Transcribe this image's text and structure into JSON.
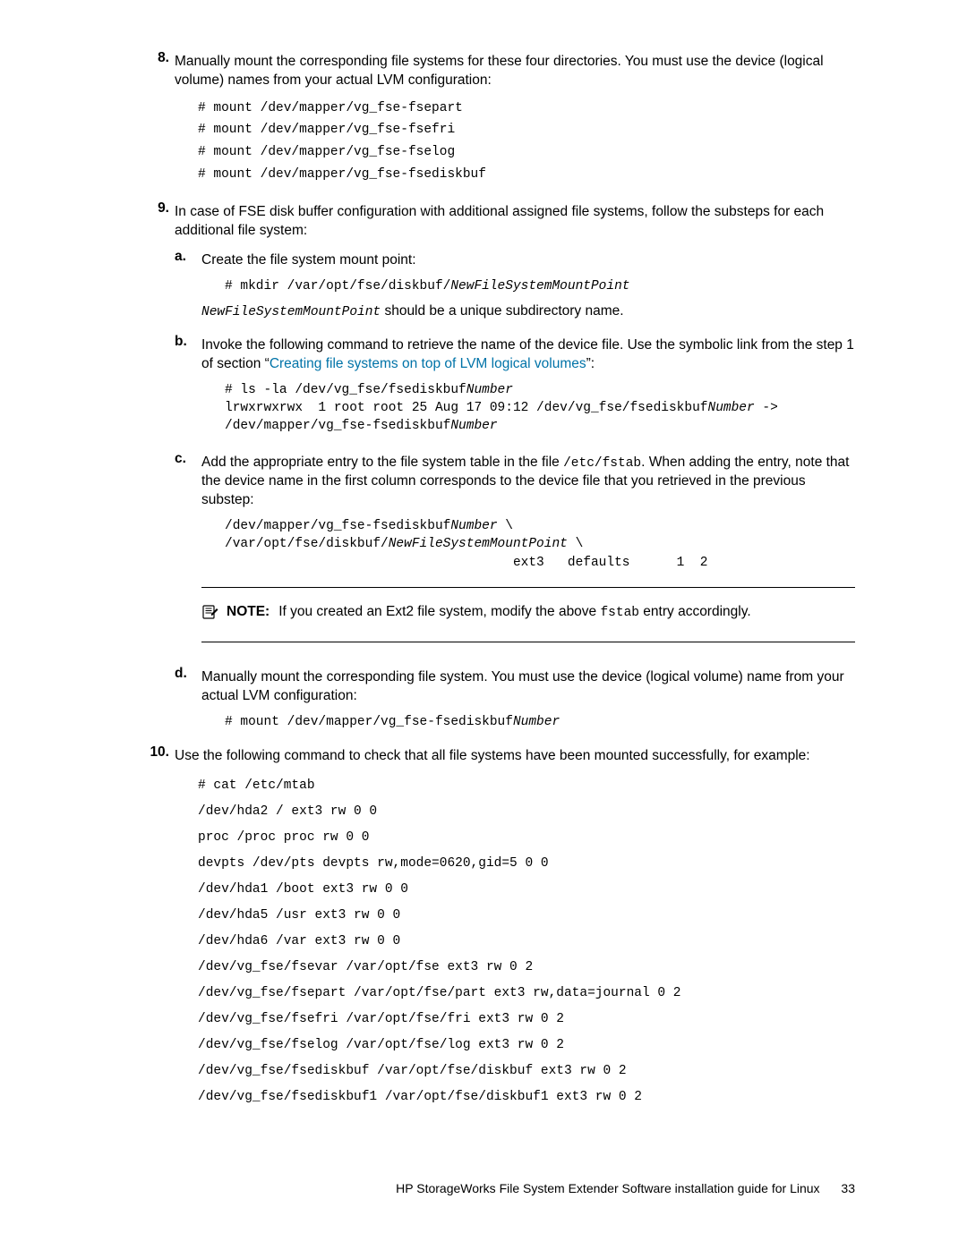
{
  "step8": {
    "num": "8.",
    "text": "Manually mount the corresponding file systems for these four directories. You must use the device (logical volume) names from your actual LVM configuration:",
    "code": "# mount /dev/mapper/vg_fse-fsepart\n# mount /dev/mapper/vg_fse-fsefri\n# mount /dev/mapper/vg_fse-fselog\n# mount /dev/mapper/vg_fse-fsediskbuf"
  },
  "step9": {
    "num": "9.",
    "text": "In case of FSE disk buffer configuration with additional assigned file systems, follow the substeps for each additional file system:",
    "a": {
      "num": "a.",
      "text": "Create the file system mount point:",
      "code_prefix": "# mkdir /var/opt/fse/diskbuf/",
      "code_italic": "NewFileSystemMountPoint",
      "after_italic": "NewFileSystemMountPoint",
      "after_text": " should be a unique subdirectory name."
    },
    "b": {
      "num": "b.",
      "text_pre": "Invoke the following command to retrieve the name of the device file. Use the symbolic link from the step 1 of section “",
      "link": "Creating file systems on top of LVM logical volumes",
      "text_post": "”:",
      "code1_prefix": "# ls -la /dev/vg_fse/fsediskbuf",
      "code1_it": "Number",
      "code2_p1": "lrwxrwxrwx  1 root root 25 Aug 17 09:12 /dev/vg_fse/fsediskbuf",
      "code2_it1": "Number",
      "code2_p2": " ->",
      "code3_p1": "/dev/mapper/vg_fse-fsediskbuf",
      "code3_it1": "Number"
    },
    "c": {
      "num": "c.",
      "t1": "Add the appropriate entry to the file system table in the file ",
      "m1": "/etc/fstab",
      "t2": ". When adding the entry, note that the device name in the first column corresponds to the device file that you retrieved in the previous substep:",
      "cl1a": "/dev/mapper/vg_fse-fsediskbuf",
      "cl1i": "Number",
      "cl1b": " \\",
      "cl2a": "/var/opt/fse/diskbuf/",
      "cl2i": "NewFileSystemMountPoint",
      "cl2b": " \\",
      "cl3": "                                     ext3   defaults      1  2"
    },
    "note": {
      "label": "NOTE:",
      "t1": "If you created an Ext2 file system, modify the above ",
      "m1": "fstab",
      "t2": " entry accordingly."
    },
    "d": {
      "num": "d.",
      "text": "Manually mount the corresponding file system. You must use the device (logical volume) name from your actual LVM configuration:",
      "code_prefix": "# mount /dev/mapper/vg_fse-fsediskbuf",
      "code_italic": "Number"
    }
  },
  "step10": {
    "num": "10.",
    "text": "Use the following command to check that all file systems have been mounted successfully, for example:",
    "code": "# cat /etc/mtab\n/dev/hda2 / ext3 rw 0 0\nproc /proc proc rw 0 0\ndevpts /dev/pts devpts rw,mode=0620,gid=5 0 0\n/dev/hda1 /boot ext3 rw 0 0\n/dev/hda5 /usr ext3 rw 0 0\n/dev/hda6 /var ext3 rw 0 0\n/dev/vg_fse/fsevar /var/opt/fse ext3 rw 0 2\n/dev/vg_fse/fsepart /var/opt/fse/part ext3 rw,data=journal 0 2\n/dev/vg_fse/fsefri /var/opt/fse/fri ext3 rw 0 2\n/dev/vg_fse/fselog /var/opt/fse/log ext3 rw 0 2\n/dev/vg_fse/fsediskbuf /var/opt/fse/diskbuf ext3 rw 0 2\n/dev/vg_fse/fsediskbuf1 /var/opt/fse/diskbuf1 ext3 rw 0 2"
  },
  "footer": {
    "title": "HP StorageWorks File System Extender Software installation guide for Linux",
    "page": "33"
  }
}
